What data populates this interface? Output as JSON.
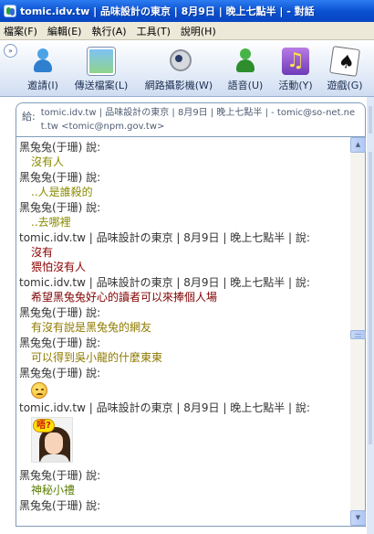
{
  "window": {
    "title": "tomic.idv.tw | 品味設計の東京 | 8月9日 | 晚上七點半 | - 對話"
  },
  "menu": [
    {
      "label": "檔案(F)"
    },
    {
      "label": "編輯(E)"
    },
    {
      "label": "執行(A)"
    },
    {
      "label": "工具(T)"
    },
    {
      "label": "說明(H)"
    }
  ],
  "toolbar": {
    "chevron": "»",
    "invite": "邀請(I)",
    "send_file": "傳送檔案(L)",
    "webcam": "網路攝影機(W)",
    "voice": "語音(U)",
    "activities": "活動(Y)",
    "games": "遊戲(G)"
  },
  "to": {
    "label": "給:",
    "value": "tomic.idv.tw | 品味設計の東京 | 8月9日 | 晚上七點半 | - tomic@so-net.net.tw <tomic@npm.gov.tw>"
  },
  "messages": [
    {
      "sender": "黑兔兔(于珊) 說:",
      "lines": [
        "沒有人"
      ]
    },
    {
      "sender": "黑兔兔(于珊) 說:",
      "lines": [
        "..人是誰殺的"
      ]
    },
    {
      "sender": "黑兔兔(于珊) 說:",
      "lines": [
        "..去哪裡"
      ]
    },
    {
      "sender": "tomic.idv.tw | 品味設計の東京 | 8月9日 | 晚上七點半 | 說:",
      "lines": [
        "沒有",
        "猥怕沒有人"
      ]
    },
    {
      "sender": "tomic.idv.tw | 品味設計の東京 | 8月9日 | 晚上七點半 | 說:",
      "lines": [
        "希望黑兔兔好心的讀者可以來捧個人場"
      ]
    },
    {
      "sender": "黑兔兔(于珊) 說:",
      "lines": [
        "有沒有說是黑兔兔的網友"
      ]
    },
    {
      "sender": "黑兔兔(于珊) 說:",
      "lines": [
        "可以得到吳小龍的什麼東東"
      ]
    },
    {
      "sender": "黑兔兔(于珊) 說:"
    },
    {
      "sender": "tomic.idv.tw | 品味設計の東京 | 8月9日 | 晚上七點半 | 說:",
      "sticker_text": "唔?"
    },
    {
      "sender": "黑兔兔(于珊) 說:",
      "lines": [
        "神秘小禮"
      ]
    },
    {
      "sender": "黑兔兔(于珊) 說:"
    }
  ],
  "scrollbar": {
    "up": "▲",
    "down": "▼"
  },
  "colors": {
    "titlebar": "#0a4fd0",
    "olive_text": "#8a8a00",
    "darkred_text": "#8b0000",
    "border": "#7f9db9"
  }
}
